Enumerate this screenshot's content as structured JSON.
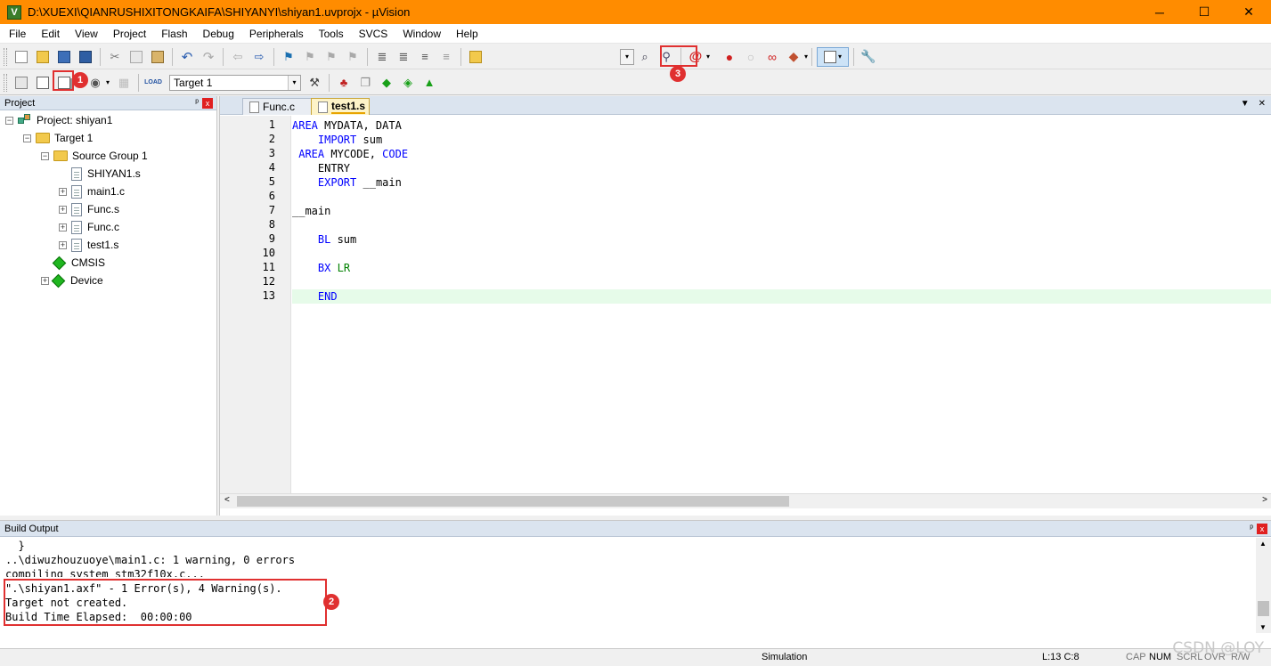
{
  "window": {
    "title": "D:\\XUEXI\\QIANRUSHIXITONGKAIFA\\SHIYANYI\\shiyan1.uvprojx - µVision",
    "app_icon": "V",
    "minimize": "─",
    "maximize": "☐",
    "close": "✕"
  },
  "menu": [
    "File",
    "Edit",
    "View",
    "Project",
    "Flash",
    "Debug",
    "Peripherals",
    "Tools",
    "SVCS",
    "Window",
    "Help"
  ],
  "toolbar2": {
    "target_value": "Target 1"
  },
  "annotations": {
    "badge1": "1",
    "badge2": "2",
    "badge3": "3"
  },
  "project_panel": {
    "title": "Project",
    "pin": "ᵖ",
    "close": "x",
    "tree": {
      "project": "Project: shiyan1",
      "target": "Target 1",
      "group": "Source Group 1",
      "files": [
        "SHIYAN1.s",
        "main1.c",
        "Func.s",
        "Func.c",
        "test1.s"
      ],
      "cmsis": "CMSIS",
      "device": "Device"
    }
  },
  "editor": {
    "tabs": [
      "Func.c",
      "test1.s"
    ],
    "active_tab": "test1.s",
    "line_numbers": [
      "1",
      "2",
      "3",
      "4",
      "5",
      "6",
      "7",
      "8",
      "9",
      "10",
      "11",
      "12",
      "13"
    ],
    "current_line": 13
  },
  "build_output": {
    "title": "Build Output",
    "lines": [
      "  }",
      "..\\diwuzhouzuoye\\main1.c: 1 warning, 0 errors",
      "compiling system_stm32f10x.c...",
      "\".\\shiyan1.axf\" - 1 Error(s), 4 Warning(s).",
      "Target not created.",
      "Build Time Elapsed:  00:00:00"
    ]
  },
  "status": {
    "mode": "Simulation",
    "position": "L:13 C:8",
    "cap": "CAP",
    "num": "NUM",
    "scrl": "SCRL",
    "ovr": "OVR",
    "rw": "R/W"
  },
  "watermark": "CSDN @LOY"
}
